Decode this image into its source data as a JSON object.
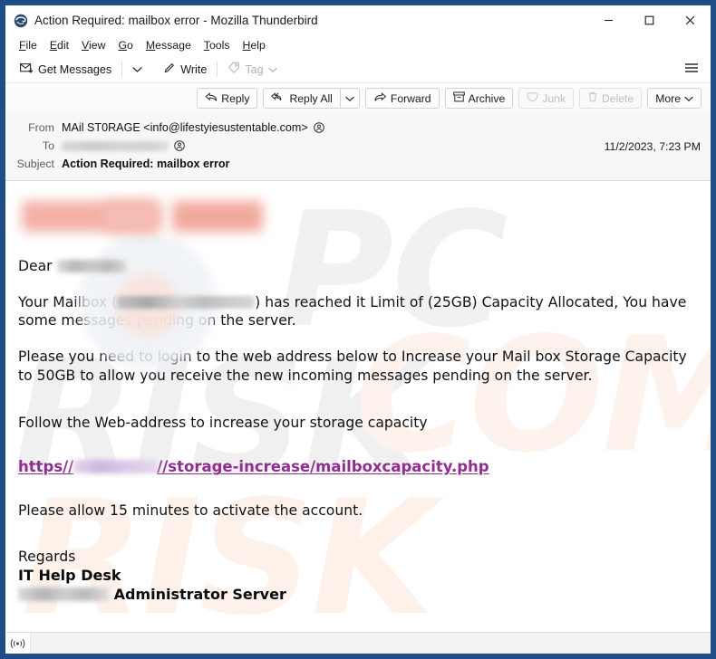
{
  "window": {
    "title": "Action Required: mailbox error - Mozilla Thunderbird",
    "app_icon": "thunderbird-icon",
    "controls": {
      "minimize": "minimize-icon",
      "maximize": "maximize-icon",
      "close": "close-icon"
    },
    "frame_color": "#1f4e87"
  },
  "menubar": {
    "items": [
      {
        "label": "File",
        "accel": "F"
      },
      {
        "label": "Edit",
        "accel": "E"
      },
      {
        "label": "View",
        "accel": "V"
      },
      {
        "label": "Go",
        "accel": "G"
      },
      {
        "label": "Message",
        "accel": "M"
      },
      {
        "label": "Tools",
        "accel": "T"
      },
      {
        "label": "Help",
        "accel": "H"
      }
    ]
  },
  "toolbar": {
    "get_messages": "Get Messages",
    "get_messages_chevron": "chevron-down-icon",
    "write": "Write",
    "tag": "Tag",
    "tag_chevron": "chevron-down-icon",
    "app_menu": "hamburger-menu-icon"
  },
  "message_actions": {
    "reply": "Reply",
    "reply_all": "Reply All",
    "reply_all_chevron": "chevron-down-icon",
    "forward": "Forward",
    "archive": "Archive",
    "junk": "Junk",
    "delete": "Delete",
    "more": "More",
    "more_chevron": "chevron-down-icon"
  },
  "headers": {
    "from_label": "From",
    "from_value": "MAil ST0RAGE <info@lifestyiesustentable.com>",
    "to_label": "To",
    "to_value_redacted": true,
    "subject_label": "Subject",
    "subject_value": "Action Required: mailbox error",
    "date": "11/2/2023, 7:23 PM"
  },
  "body": {
    "watermarks": [
      "PC",
      "RISK",
      "COM",
      "RISK"
    ],
    "greeting_prefix": "Dear",
    "greeting_name_redacted": true,
    "para1_a": "Your Mailbox (",
    "para1_b": ") has reached it Limit of  (25GB) Capacity Allocated, You have some messages pending on the server.",
    "para2": "Please you need to login to the web address below to Increase your Mail box Storage Capacity to 50GB to allow you receive the new incoming messages pending on the server.",
    "para3": "Follow the Web-address to increase your storage capacity",
    "link_prefix": "https//",
    "link_suffix": "//storage-increase/mailboxcapacity.php",
    "link_color": "#8e2f8e",
    "para4": "Please allow 15 minutes to activate the account.",
    "sign_regards": "Regards",
    "sign_dept": "IT Help Desk",
    "sign_role": "Administrator Server",
    "limit_current": "25GB",
    "limit_upgrade": "50GB",
    "activation_minutes": "15"
  },
  "statusbar": {
    "icon": "network-activity-icon",
    "text": ""
  }
}
